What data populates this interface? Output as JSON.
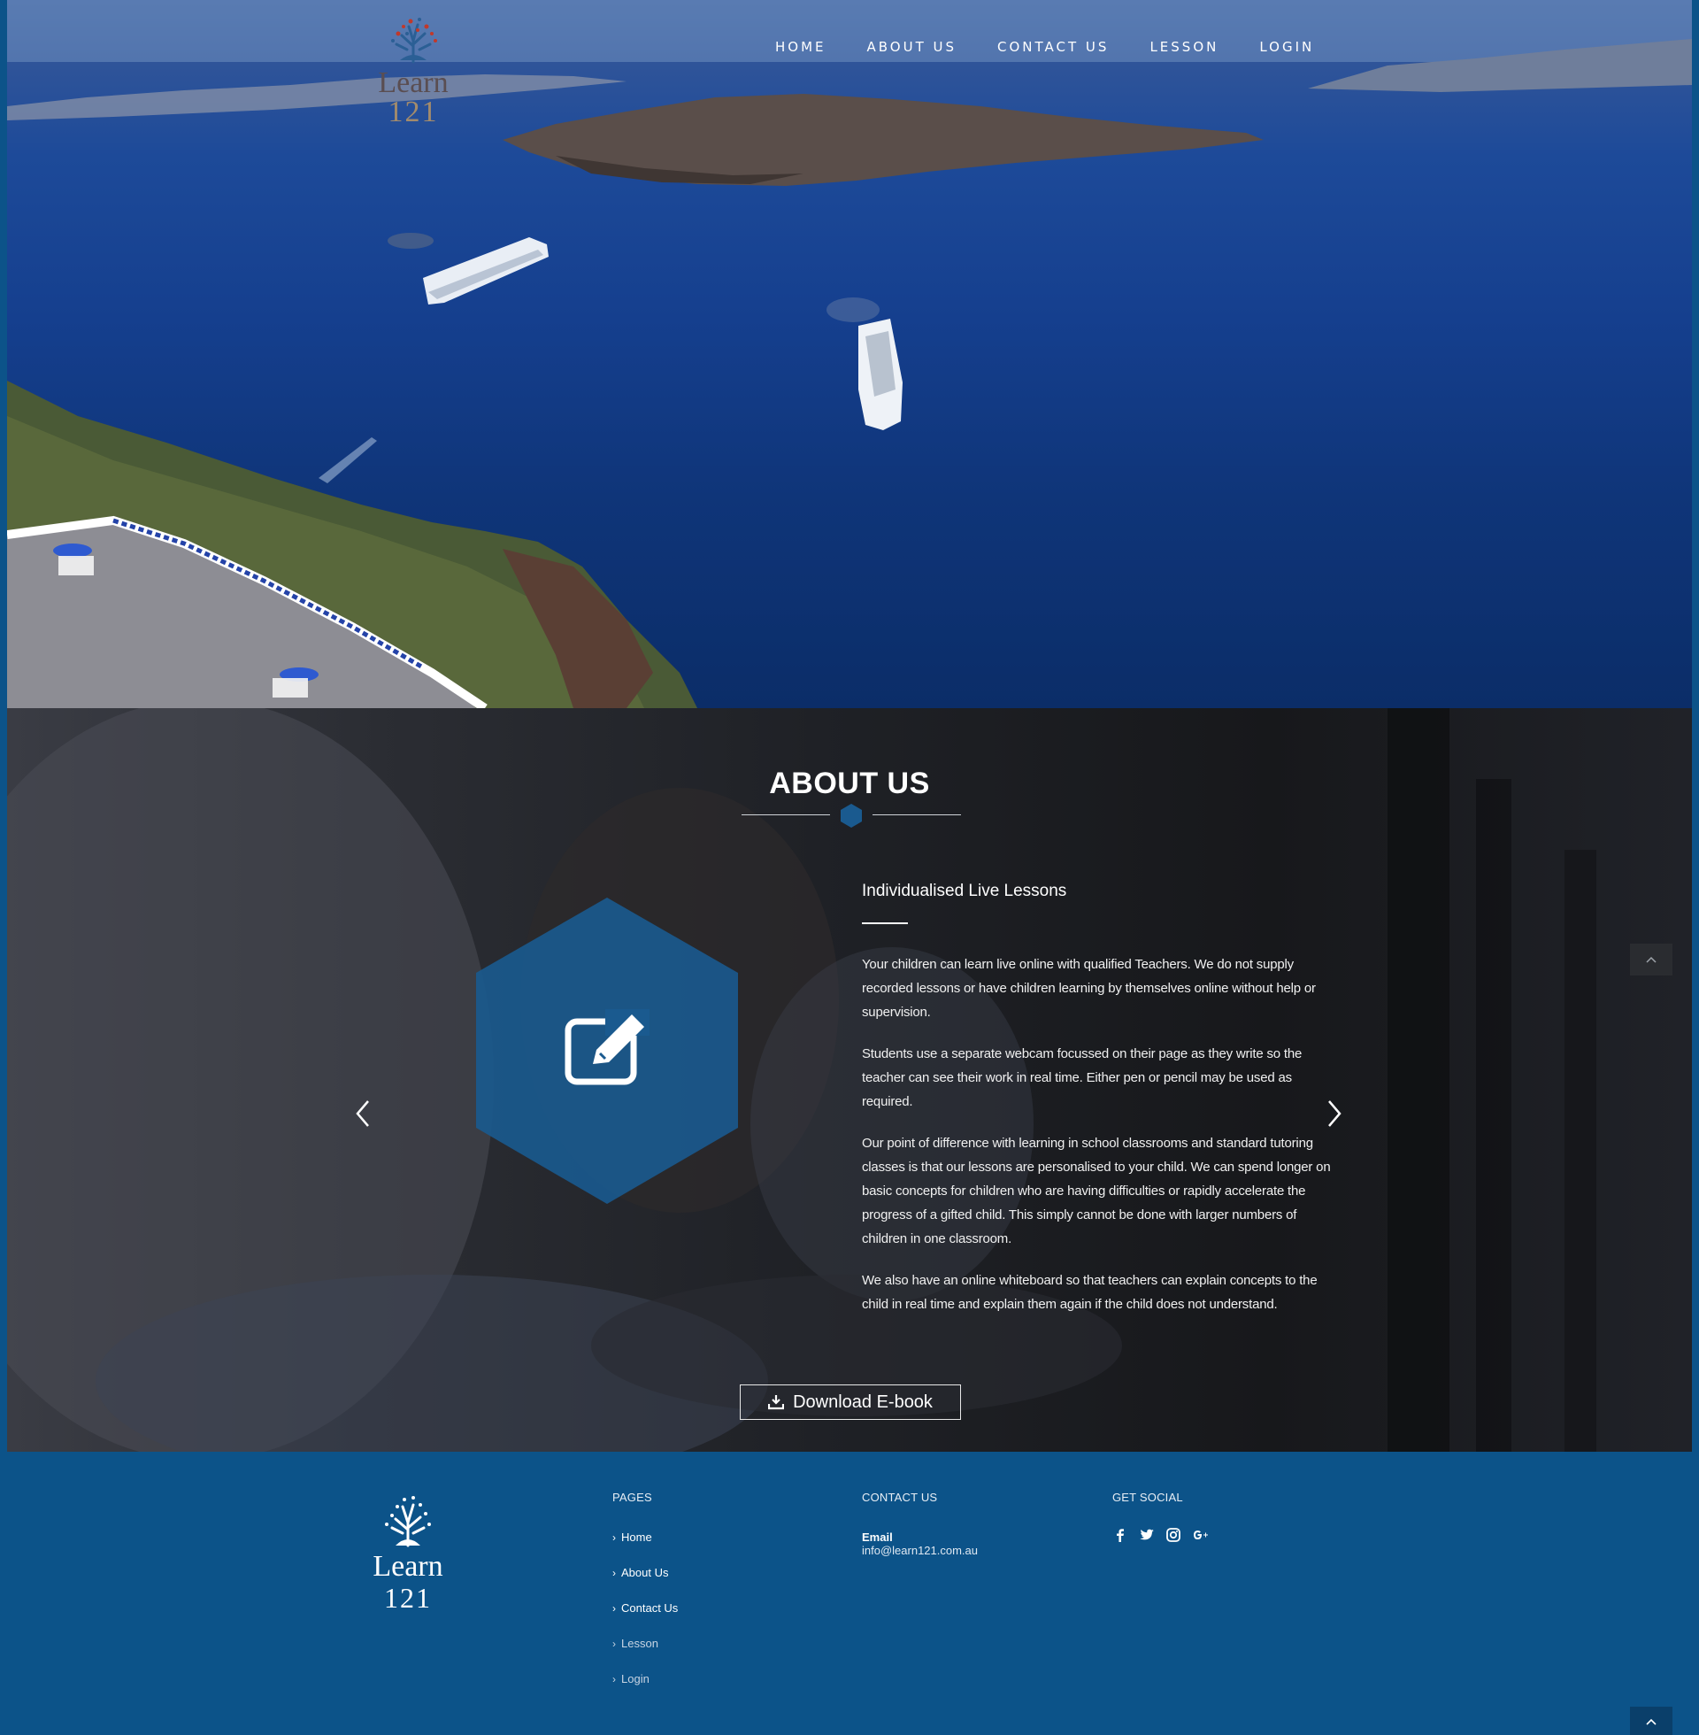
{
  "site": {
    "logo_word": "Learn",
    "logo_number": "121"
  },
  "nav": {
    "items": [
      "HOME",
      "ABOUT US",
      "CONTACT US",
      "LESSON",
      "LOGIN"
    ]
  },
  "about": {
    "title": "ABOUT US",
    "heading": "Individualised Live Lessons",
    "paragraphs": [
      "Your children can learn live online with qualified Teachers. We do not supply recorded lessons or have children learning by themselves online without help or supervision.",
      "Students use a separate webcam focussed on their page as they write so the teacher can see their work in real time. Either pen or pencil may be used as required.",
      "Our point of difference with learning in school classrooms and standard tutoring classes is that our lessons are personalised to your child. We can spend longer on basic concepts for children who are having difficulties or rapidly accelerate the progress of a gifted child. This simply cannot be done with larger numbers of children in one classroom.",
      "We also have an online whiteboard so that teachers can explain concepts to the child in real time and explain them again if the child does not understand."
    ],
    "cta_label": "Download E-book",
    "hex_icon": "edit-icon",
    "accent": "#1a5a8f"
  },
  "footer": {
    "pages_heading": "PAGES",
    "pages": [
      "Home",
      "About Us",
      "Contact Us",
      "Lesson",
      "Login"
    ],
    "contact_heading": "CONTACT US",
    "email_label": "Email",
    "email_value": "info@learn121.com.au",
    "social_heading": "GET SOCIAL",
    "social_icons": [
      "facebook-icon",
      "twitter-icon",
      "instagram-icon",
      "google-plus-icon"
    ],
    "bg": "#0c5389"
  }
}
